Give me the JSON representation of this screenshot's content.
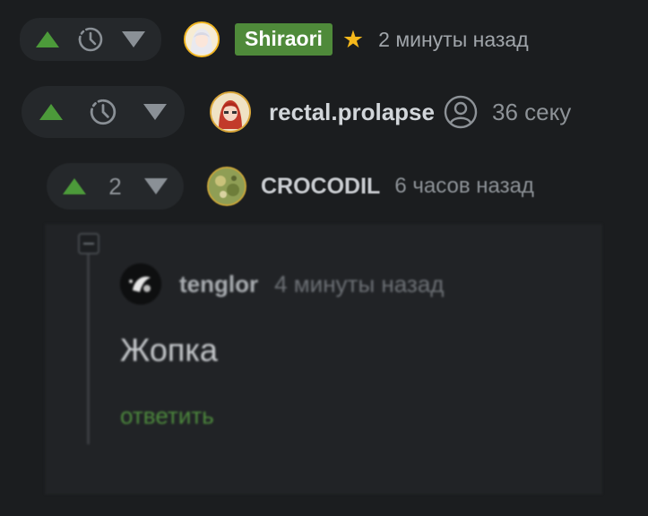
{
  "colors": {
    "background": "#1b1d1f",
    "vote_pill": "#25282b",
    "upvote": "#4c9a3a",
    "downvote": "#8a9096",
    "badge": "#4f8a3a",
    "star": "#f5b81b",
    "reply_link": "#4d8a3d"
  },
  "comments": [
    {
      "vote": {
        "up_icon": "arrow-up-icon",
        "middle_icon": "clock-icon",
        "down_icon": "arrow-down-icon"
      },
      "avatar_icon": "avatar-anime-girl",
      "username": "Shiraori",
      "username_badge": true,
      "star_icon": "star-icon",
      "star_glyph": "★",
      "time": "2 минуты назад"
    },
    {
      "vote": {
        "up_icon": "arrow-up-icon",
        "middle_icon": "clock-icon",
        "down_icon": "arrow-down-icon"
      },
      "avatar_icon": "avatar-red-hair",
      "username": "rectal.prolapse",
      "user_icon": "user-circle-icon",
      "time": "36 секу"
    },
    {
      "vote": {
        "up_icon": "arrow-up-icon",
        "count": "2",
        "down_icon": "arrow-down-icon"
      },
      "avatar_icon": "avatar-crocodile",
      "username": "CROCODIL",
      "time": "6 часов назад"
    }
  ],
  "reply": {
    "collapse_icon": "minus-square-icon",
    "avatar_icon": "avatar-dark",
    "username": "tenglor",
    "time": "4 минуты назад",
    "text": "Жопка",
    "action": "ответить"
  }
}
